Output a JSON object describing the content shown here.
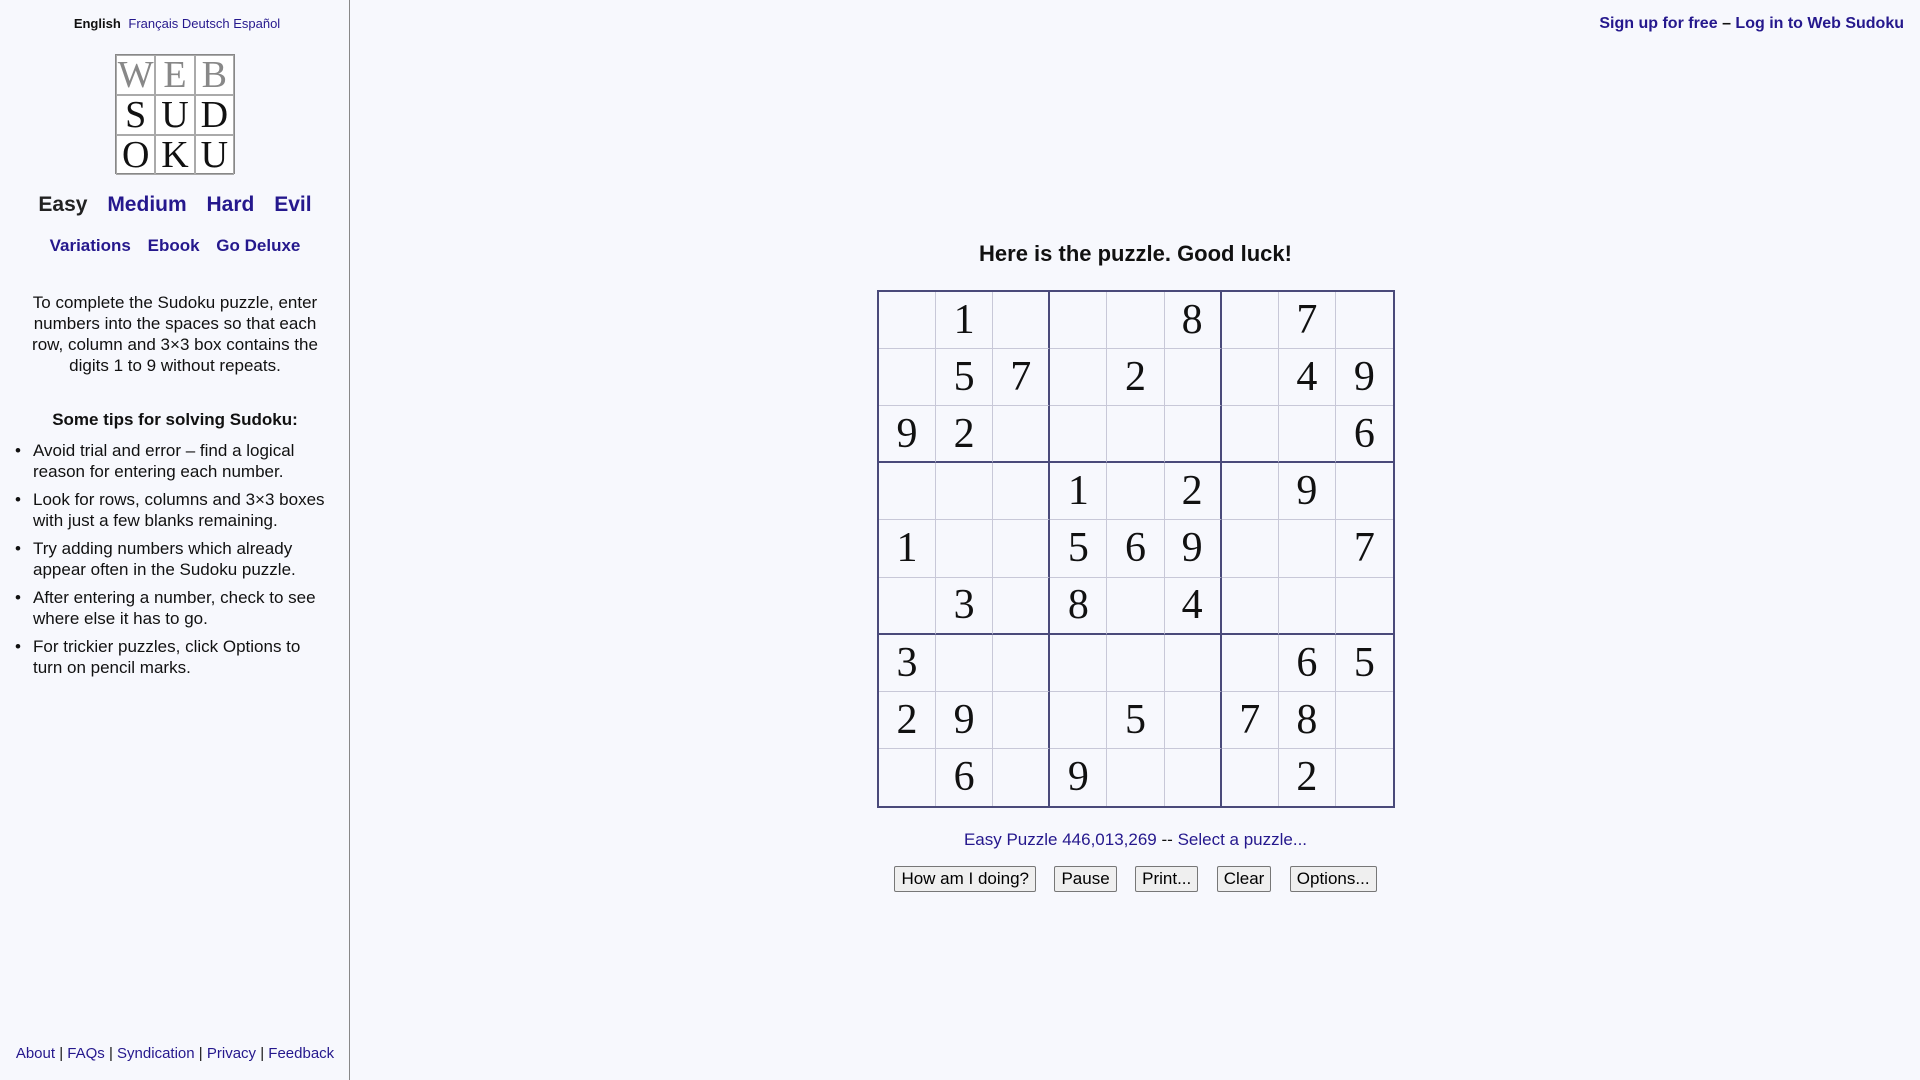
{
  "languages": [
    {
      "label": "English",
      "current": true
    },
    {
      "label": "Français",
      "current": false
    },
    {
      "label": "Deutsch",
      "current": false
    },
    {
      "label": "Español",
      "current": false
    }
  ],
  "logo": [
    "W",
    "E",
    "B",
    "S",
    "U",
    "D",
    "O",
    "K",
    "U"
  ],
  "levels": {
    "easy": "Easy",
    "medium": "Medium",
    "hard": "Hard",
    "evil": "Evil"
  },
  "extras": {
    "variations": "Variations",
    "ebook": "Ebook",
    "deluxe": "Go Deluxe"
  },
  "intro": "To complete the Sudoku puzzle, enter numbers into the spaces so that each row, column and 3×3 box contains the digits 1 to 9 without repeats.",
  "tips": {
    "title": "Some tips for solving Sudoku:",
    "items": [
      "Avoid trial and error – find a logical reason for entering each number.",
      "Look for rows, columns and 3×3 boxes with just a few blanks remaining.",
      "Try adding numbers which already appear often in the Sudoku puzzle.",
      "After entering a number, check to see where else it has to go.",
      "For trickier puzzles, click Options to turn on pencil marks."
    ]
  },
  "footer": {
    "about": "About",
    "faqs": "FAQs",
    "syndication": "Syndication",
    "privacy": "Privacy",
    "feedback": "Feedback",
    "separator": "|"
  },
  "account": {
    "signup": "Sign up for free",
    "separator": "–",
    "login": "Log in to Web Sudoku"
  },
  "puzzle": {
    "title": "Here is the puzzle. Good luck!",
    "grid": [
      [
        "",
        "1",
        "",
        "",
        "",
        "8",
        "",
        "7",
        ""
      ],
      [
        "",
        "5",
        "7",
        "",
        "2",
        "",
        "",
        "4",
        "9"
      ],
      [
        "9",
        "2",
        "",
        "",
        "",
        "",
        "",
        "",
        "6"
      ],
      [
        "",
        "",
        "",
        "1",
        "",
        "2",
        "",
        "9",
        ""
      ],
      [
        "1",
        "",
        "",
        "5",
        "6",
        "9",
        "",
        "",
        "7"
      ],
      [
        "",
        "3",
        "",
        "8",
        "",
        "4",
        "",
        "",
        ""
      ],
      [
        "3",
        "",
        "",
        "",
        "",
        "",
        "",
        "6",
        "5"
      ],
      [
        "2",
        "9",
        "",
        "",
        "5",
        "",
        "7",
        "8",
        ""
      ],
      [
        "",
        "6",
        "",
        "9",
        "",
        "",
        "",
        "2",
        ""
      ]
    ],
    "id_label": "Easy Puzzle 446,013,269",
    "dashes": "--",
    "select_label": "Select a puzzle..."
  },
  "buttons": {
    "how": "How am I doing?",
    "pause": "Pause",
    "print": "Print...",
    "clear": "Clear",
    "options": "Options..."
  },
  "colors": {
    "link": "#25188d",
    "background": "#f7f8fd",
    "grid_border": "#4a4a7a"
  }
}
